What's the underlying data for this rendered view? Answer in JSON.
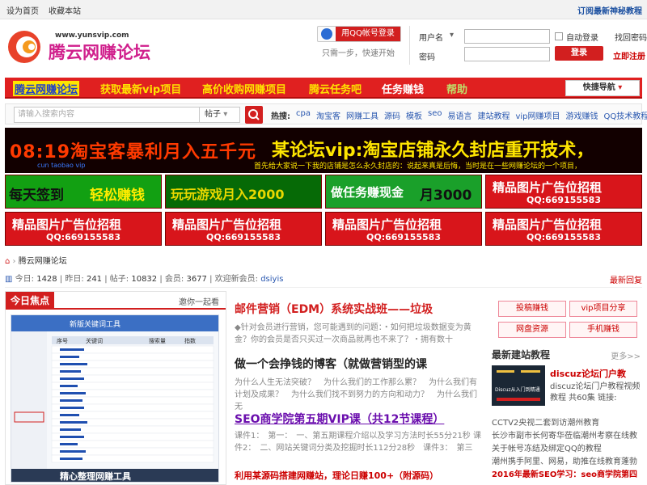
{
  "topbar": {
    "set_home": "设为首页",
    "bookmark": "收藏本站",
    "subscribe": "订阅最新神秘教程"
  },
  "header": {
    "logo_url": "www.yunsvip.com",
    "logo_title": "腾云网赚论坛",
    "qq_login": "用QQ帐号登录",
    "qq_tip": "只需一步，快速开始",
    "username_label": "用户名",
    "password_label": "密码",
    "auto_login": "自动登录",
    "find_password": "找回密码",
    "login_btn": "登录",
    "register": "立即注册"
  },
  "nav": {
    "items": [
      "腾云网赚论坛",
      "获取最新vip项目",
      "高价收购网赚项目",
      "腾云任务吧",
      "任务赚钱",
      "帮助"
    ],
    "quick_nav": "快捷导航"
  },
  "search": {
    "placeholder": "请输入搜索内容",
    "scope": "帖子",
    "hot_label": "热搜:",
    "hot_words": [
      "cpa",
      "淘宝客",
      "网赚工具",
      "源码",
      "模板",
      "seo",
      "易语言",
      "建站教程",
      "vip网赚项目",
      "游戏赚钱",
      "QQ技术教程"
    ]
  },
  "banner": {
    "line1": "08:19淘宝客暴利月入五千元",
    "line2": "某论坛vip:淘宝店铺永久封店重开技术，",
    "line3": "首先给大家说一下我的店铺是怎么永久封店的：说起来真是后悔，当时是在一些网赚论坛的一个项目，",
    "tiny": "cun taobao vip"
  },
  "ads": {
    "sign_text": "每天签到",
    "sign_text2": "轻松赚钱",
    "play_text": "玩玩游戏月入2000",
    "task_text": "做任务赚现金",
    "task_text2": "月3000",
    "recruit": "精品图片广告位招租",
    "qq": "QQ:669155583"
  },
  "breadcrumb": {
    "home": "腾云网赚论坛"
  },
  "stats": {
    "today_label": "今日:",
    "today": "1428",
    "yesterday_label": "昨日:",
    "yesterday": "241",
    "posts_label": "帖子:",
    "posts": "10832",
    "members_label": "会员:",
    "members": "3677",
    "welcome": "欢迎新会员:",
    "new_member": "dsiyis",
    "latest": "最新回复"
  },
  "focus": {
    "title": "今日焦点",
    "more": "邀你一起看",
    "shot_title": "新版关键词工具",
    "shot_footer": "精心整理网赚工具",
    "shot_header_cells": [
      "序号",
      "关键词",
      "搜索量",
      "指数"
    ]
  },
  "articles": [
    {
      "title": "邮件营销（EDM）系统实战班——垃圾",
      "desc": "◆针对会员进行营销，您可能遇到的问题：・如何把垃圾数据变为黄金？你的会员是否只买过一次商品就再也不来了？・拥有数十"
    },
    {
      "title": "做一个会挣钱的博客（就做营销型的课",
      "desc": "为什么人生无法突破？　为什么我们的工作那么累？　为什么我们有计划及成果？　为什么我们找不到努力的方向和动力？　为什么我们无"
    },
    {
      "title": "SEO商学院第五期VIP课（共12节课程）",
      "desc": "课件1：　第一：　一、第五期课程介绍以及学习方法时长55分21秒 课件2：　二、网站关键词分类及挖掘时长112分28秒　课件3：　第三"
    },
    {
      "title": "利用某源码搭建网赚站，理论日赚100+（附源码）",
      "desc": ""
    }
  ],
  "sidebar": {
    "buttons": [
      "投稿赚钱",
      "vip项目分享",
      "网盘资源",
      "手机赚钱"
    ],
    "title": "最新建站教程",
    "more": "更多>>",
    "feature_title": "discuz论坛门户教",
    "feature_desc": "discuz论坛门户教程视频教程 共60集 链接:",
    "thumb_text": "Discuz从入门到精通",
    "list": [
      "CCTV2央视二套到访潮州教育",
      "长沙市副市长何寄华莅临潮州考察在线教",
      "关于帐号冻结及绑定QQ的教程",
      "潮州携手阿里、网易，助推在线教育蓬勃",
      "2016年最新SEO学习：seo商学院第四"
    ]
  },
  "colors": {
    "brand_red": "#d21f1f",
    "nav_yellow": "#ffe200",
    "link_blue": "#2a58b0",
    "nav_green": "#0a7a0a"
  }
}
